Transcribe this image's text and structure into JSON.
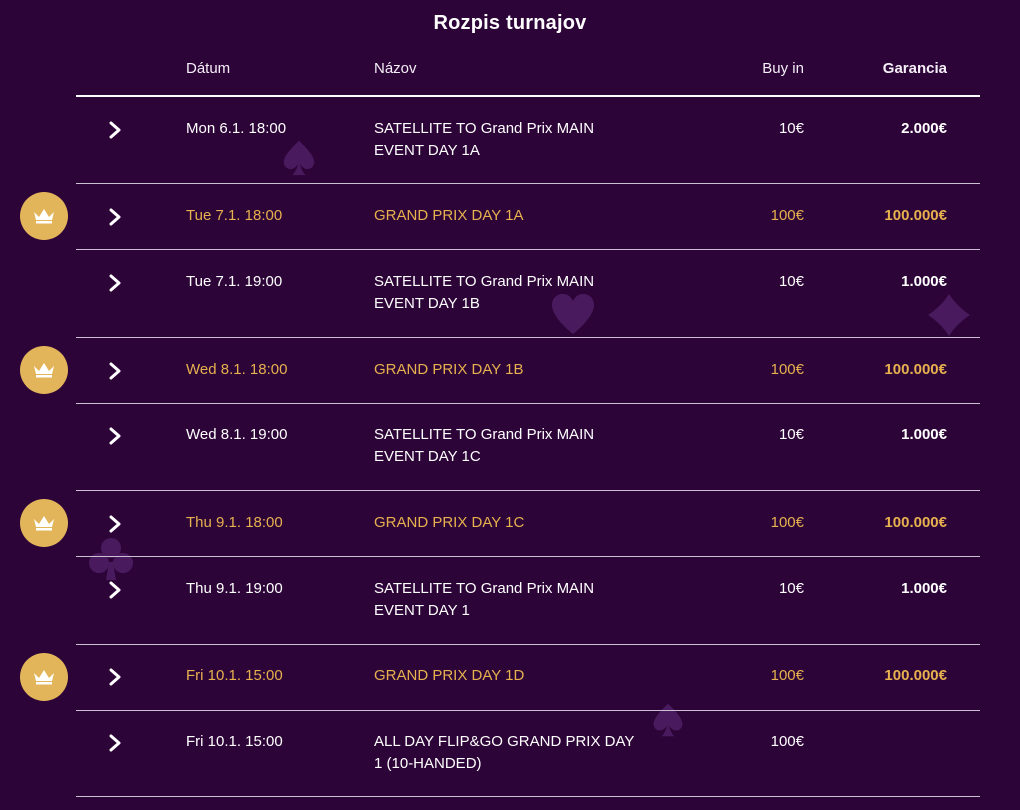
{
  "title": "Rozpis turnajov",
  "columns": {
    "date": "Dátum",
    "name": "Názov",
    "buyin": "Buy in",
    "guarantee": "Garancia"
  },
  "rows": [
    {
      "date": "Mon 6.1. 18:00",
      "name": "SATELLITE TO Grand Prix MAIN EVENT DAY 1A",
      "buyin": "10€",
      "guarantee": "2.000€",
      "featured": false
    },
    {
      "date": "Tue 7.1. 18:00",
      "name": "GRAND PRIX DAY 1A",
      "buyin": "100€",
      "guarantee": "100.000€",
      "featured": true
    },
    {
      "date": "Tue 7.1. 19:00",
      "name": "SATELLITE TO Grand Prix MAIN EVENT DAY 1B",
      "buyin": "10€",
      "guarantee": "1.000€",
      "featured": false
    },
    {
      "date": "Wed 8.1. 18:00",
      "name": "GRAND PRIX DAY 1B",
      "buyin": "100€",
      "guarantee": "100.000€",
      "featured": true
    },
    {
      "date": "Wed 8.1. 19:00",
      "name": "SATELLITE TO Grand Prix MAIN EVENT DAY 1C",
      "buyin": "10€",
      "guarantee": "1.000€",
      "featured": false
    },
    {
      "date": "Thu 9.1. 18:00",
      "name": "GRAND PRIX DAY 1C",
      "buyin": "100€",
      "guarantee": "100.000€",
      "featured": true
    },
    {
      "date": "Thu 9.1. 19:00",
      "name": "SATELLITE TO Grand Prix MAIN EVENT DAY 1",
      "buyin": "10€",
      "guarantee": "1.000€",
      "featured": false
    },
    {
      "date": "Fri 10.1. 15:00",
      "name": "GRAND PRIX DAY 1D",
      "buyin": "100€",
      "guarantee": "100.000€",
      "featured": true
    },
    {
      "date": "Fri 10.1. 15:00",
      "name": "ALL DAY FLIP&GO GRAND PRIX DAY 1 (10-HANDED)",
      "buyin": "100€",
      "guarantee": "",
      "featured": false
    }
  ],
  "colors": {
    "background": "#2d0438",
    "text": "#ffffff",
    "featured_text": "#e6b14e",
    "crown_badge": "#e3b55a",
    "suit_deco": "#4a1a5e"
  },
  "icons": {
    "expand": "chevron-right-icon",
    "featured": "crown-icon",
    "decorations": [
      "spade-icon",
      "heart-icon",
      "diamond-icon",
      "club-icon",
      "spade-icon"
    ]
  }
}
